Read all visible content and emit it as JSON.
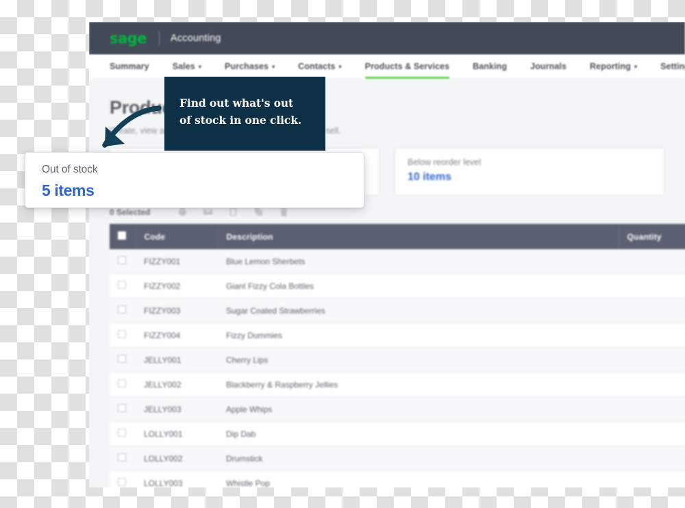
{
  "brand": {
    "logo_text": "sage",
    "product": "Accounting",
    "logo_color": "#00b53f",
    "bar_color": "#434a57"
  },
  "nav": {
    "items": [
      {
        "label": "Summary",
        "has_caret": false,
        "active": false
      },
      {
        "label": "Sales",
        "has_caret": true,
        "active": false
      },
      {
        "label": "Purchases",
        "has_caret": true,
        "active": false
      },
      {
        "label": "Contacts",
        "has_caret": true,
        "active": false
      },
      {
        "label": "Products & Services",
        "has_caret": false,
        "active": true
      },
      {
        "label": "Banking",
        "has_caret": false,
        "active": false
      },
      {
        "label": "Journals",
        "has_caret": false,
        "active": false
      },
      {
        "label": "Reporting",
        "has_caret": true,
        "active": false
      },
      {
        "label": "Settings",
        "has_caret": false,
        "active": false
      }
    ],
    "active_underline_color": "#63d44a"
  },
  "page": {
    "title": "Products & Services",
    "subtitle": "Create, view and manage the products and services you sell."
  },
  "tiles": [
    {
      "label": "Out of stock",
      "value": "5 items",
      "value_color": "#3366cc"
    },
    {
      "label": "Below reorder level",
      "value": "10 items",
      "value_color": "#3366cc"
    }
  ],
  "toolbar": {
    "selected_count": "0 Selected",
    "icons": [
      "print-icon",
      "email-icon",
      "copy-icon",
      "duplicate-icon",
      "delete-icon"
    ]
  },
  "table": {
    "columns": [
      "",
      "Code",
      "Description",
      "Quantity"
    ],
    "rows": [
      {
        "code": "FIZZY001",
        "description": "Blue Lemon Sherbets"
      },
      {
        "code": "FIZZY002",
        "description": "Giant Fizzy Cola Bottles"
      },
      {
        "code": "FIZZY003",
        "description": "Sugar Coated Strawberries"
      },
      {
        "code": "FIZZY004",
        "description": "Fizzy Dummies"
      },
      {
        "code": "JELLY001",
        "description": "Cherry Lips"
      },
      {
        "code": "JELLY002",
        "description": "Blackberry & Raspberry Jellies"
      },
      {
        "code": "JELLY003",
        "description": "Apple Whips"
      },
      {
        "code": "LOLLY001",
        "description": "Dip Dab"
      },
      {
        "code": "LOLLY002",
        "description": "Drumstick"
      },
      {
        "code": "LOLLY003",
        "description": "Whistle Pop"
      }
    ]
  },
  "callout": {
    "line1": "Find out what's out",
    "line2": "of stock in one click.",
    "background": "#0d3046"
  },
  "focus_card": {
    "label": "Out of stock",
    "value": "5 items",
    "value_color": "#2f65cf"
  },
  "annotation": {
    "arrow": "curved-arrow-icon",
    "arrow_color": "#134054"
  }
}
